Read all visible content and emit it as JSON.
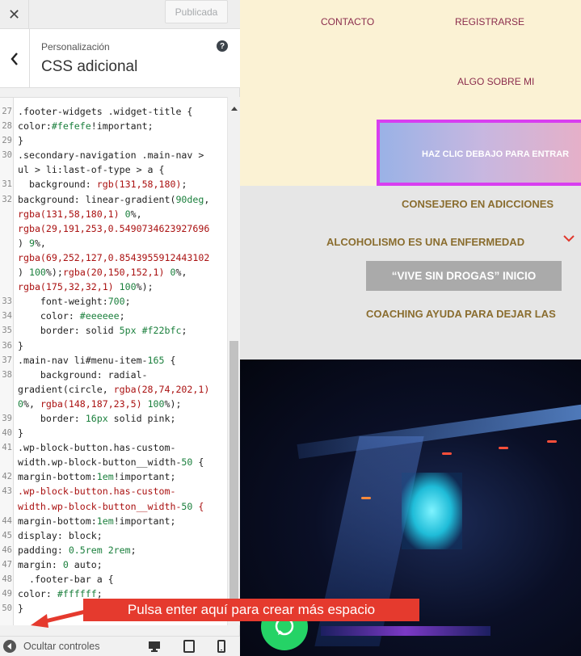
{
  "topbar": {
    "close_icon": "close-icon",
    "publish_label": "Publicada"
  },
  "header": {
    "subtitle": "Personalización",
    "title": "CSS adicional",
    "help_icon": "help-icon"
  },
  "editor": {
    "lines": [
      {
        "n": "27",
        "text": ".footer-widgets .widget-title {"
      },
      {
        "n": "28",
        "text": "color:#fefefe!important;"
      },
      {
        "n": "29",
        "text": "}"
      },
      {
        "n": "30",
        "text": ".secondary-navigation .main-nav >"
      },
      {
        "n": "",
        "text": "ul > li:last-of-type > a {"
      },
      {
        "n": "31",
        "text": "  background: rgb(131,58,180);"
      },
      {
        "n": "32",
        "text": "background: linear-gradient(90deg,"
      },
      {
        "n": "",
        "text": "rgba(131,58,180,1) 0%,"
      },
      {
        "n": "",
        "text": "rgba(29,191,253,0.5490734623927696"
      },
      {
        "n": "",
        "text": ") 9%,"
      },
      {
        "n": "",
        "text": "rgba(69,252,127,0.8543955912443102"
      },
      {
        "n": "",
        "text": ") 100%);rgba(20,150,152,1) 0%,"
      },
      {
        "n": "",
        "text": "rgba(175,32,32,1) 100%);"
      },
      {
        "n": "33",
        "text": "    font-weight:700;"
      },
      {
        "n": "34",
        "text": "    color: #eeeeee;"
      },
      {
        "n": "35",
        "text": "    border: solid 5px #f22bfc;"
      },
      {
        "n": "36",
        "text": "}"
      },
      {
        "n": "37",
        "text": ".main-nav li#menu-item-165 {"
      },
      {
        "n": "38",
        "text": "    background: radial-"
      },
      {
        "n": "",
        "text": "gradient(circle, rgba(28,74,202,1)"
      },
      {
        "n": "",
        "text": "0%, rgba(148,187,23,5) 100%);"
      },
      {
        "n": "39",
        "text": "    border: 16px solid pink;"
      },
      {
        "n": "40",
        "text": "}"
      },
      {
        "n": "41",
        "text": ".wp-block-button.has-custom-"
      },
      {
        "n": "",
        "text": "width.wp-block-button__width-50 {"
      },
      {
        "n": "42",
        "text": "margin-bottom:1em!important;"
      },
      {
        "n": "43",
        "text": ".wp-block-button.has-custom-"
      },
      {
        "n": "",
        "text": "width.wp-block-button__width-50 {"
      },
      {
        "n": "44",
        "text": "margin-bottom:1em!important;"
      },
      {
        "n": "45",
        "text": "display: block;"
      },
      {
        "n": "46",
        "text": "padding: 0.5rem 2rem;"
      },
      {
        "n": "47",
        "text": "margin: 0 auto;"
      },
      {
        "n": "48",
        "text": "  .footer-bar a {"
      },
      {
        "n": "49",
        "text": "color: #ffffff;"
      },
      {
        "n": "50",
        "text": "}"
      }
    ]
  },
  "footer": {
    "hide_label": "Ocultar controles",
    "devices": [
      "desktop-icon",
      "tablet-icon",
      "mobile-icon"
    ]
  },
  "preview": {
    "top_links": {
      "contacto": "CONTACTO",
      "registrarse": "REGISTRARSE",
      "algo": "ALGO SOBRE MI"
    },
    "cta": "HAZ CLIC DEBAJO PARA ENTRAR",
    "menu": {
      "consejero": "CONSEJERO EN ADICCIONES",
      "alcoholismo": "ALCOHOLISMO ES UNA ENFERMEDAD",
      "vive": "“VIVE SIN DROGAS” INICIO",
      "coaching": "COACHING AYUDA PARA DEJAR LAS"
    }
  },
  "annotation": {
    "text": "Pulsa enter aquí para crear más espacio",
    "color": "#e53a2e"
  }
}
